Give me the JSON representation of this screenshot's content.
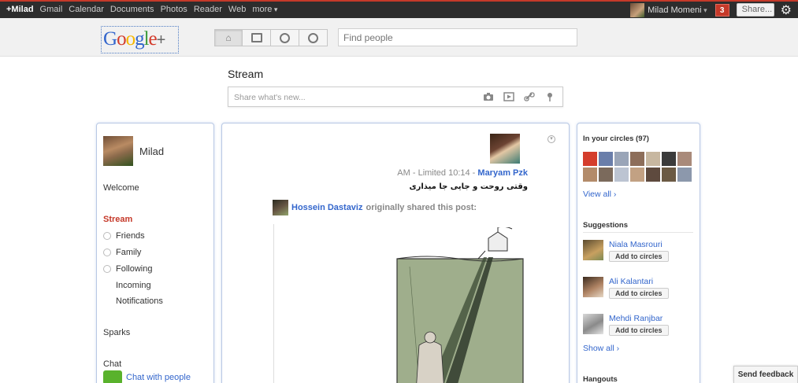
{
  "topbar": {
    "nav": [
      "+Milad",
      "Gmail",
      "Calendar",
      "Documents",
      "Photos",
      "Reader",
      "Web",
      "more"
    ],
    "user_name": "Milad Momeni",
    "notifications": "3",
    "share_label": "Share..."
  },
  "header": {
    "logo": "Google+",
    "search_placeholder": "Find people"
  },
  "stream": {
    "title": "Stream",
    "share_placeholder": "Share what's new..."
  },
  "left_nav": {
    "profile_name": "Milad",
    "welcome": "Welcome",
    "stream": "Stream",
    "friends": "Friends",
    "family": "Family",
    "following": "Following",
    "incoming": "Incoming",
    "notifications": "Notifications",
    "sparks": "Sparks",
    "chat": "Chat",
    "chat_link": "Chat with people"
  },
  "post": {
    "meta_time": "AM  -  Limited 10:14  -",
    "author": "Maryam Pzk",
    "text": "وقتی روحت و جایی جا میذاری",
    "reshared_by": "Hossein Dastaviz",
    "reshared_suffix": "originally shared this post:"
  },
  "right_col": {
    "circles_title": "In your circles (97)",
    "view_all": "View all ›",
    "suggestions_title": "Suggestions",
    "suggestions": [
      {
        "name": "Niala Masrouri",
        "button": "Add to circles"
      },
      {
        "name": "Ali Kalantari",
        "button": "Add to circles"
      },
      {
        "name": "Mehdi Ranjbar",
        "button": "Add to circles"
      }
    ],
    "show_all": "Show all ›",
    "hangouts_title": "Hangouts"
  },
  "feedback": "Send feedback",
  "colors": {
    "accent_red": "#c53929",
    "link_blue": "#3366cc",
    "card_border": "#b9c8e4"
  }
}
